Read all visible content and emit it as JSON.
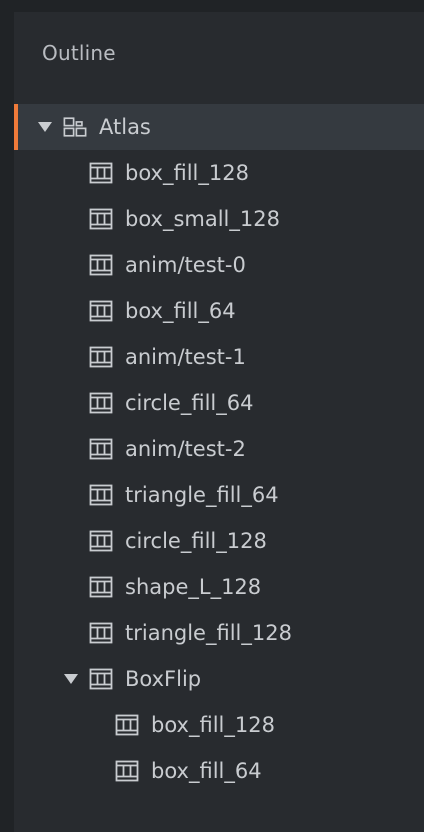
{
  "outline": {
    "title": "Outline",
    "root": {
      "label": "Atlas",
      "icon": "atlas-icon",
      "expanded": true,
      "selected": true
    },
    "items": [
      {
        "label": "box_fill_128",
        "icon": "image-icon"
      },
      {
        "label": "box_small_128",
        "icon": "image-icon"
      },
      {
        "label": "anim/test-0",
        "icon": "image-icon"
      },
      {
        "label": "box_fill_64",
        "icon": "image-icon"
      },
      {
        "label": "anim/test-1",
        "icon": "image-icon"
      },
      {
        "label": "circle_fill_64",
        "icon": "image-icon"
      },
      {
        "label": "anim/test-2",
        "icon": "image-icon"
      },
      {
        "label": "triangle_fill_64",
        "icon": "image-icon"
      },
      {
        "label": "circle_fill_128",
        "icon": "image-icon"
      },
      {
        "label": "shape_L_128",
        "icon": "image-icon"
      },
      {
        "label": "triangle_fill_128",
        "icon": "image-icon"
      }
    ],
    "group": {
      "label": "BoxFlip",
      "icon": "animation-icon",
      "expanded": true,
      "children": [
        {
          "label": "box_fill_128",
          "icon": "image-icon"
        },
        {
          "label": "box_fill_64",
          "icon": "image-icon"
        }
      ]
    }
  },
  "colors": {
    "background": "#202326",
    "panel": "#282b2f",
    "selected_row": "#353a40",
    "accent": "#f07b3a",
    "text": "#c9ccd0",
    "title_text": "#b9bcc1",
    "icon": "#c9ccd0"
  }
}
